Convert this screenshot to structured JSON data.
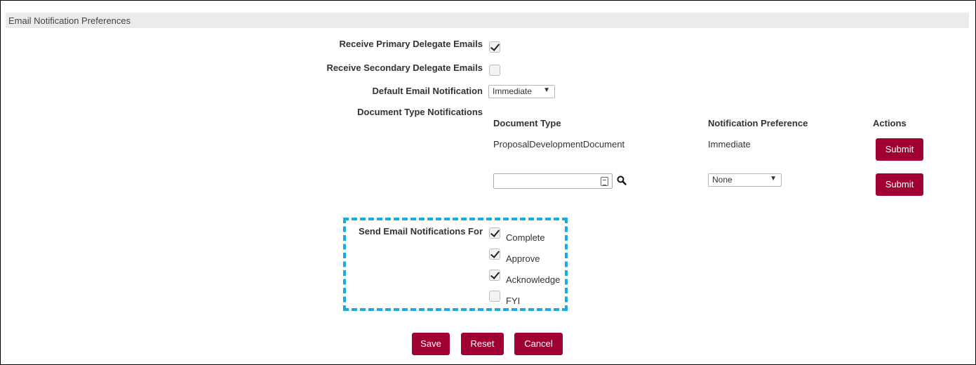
{
  "section": {
    "title": "Email Notification Preferences"
  },
  "fields": {
    "primary_delegate": {
      "label": "Receive Primary Delegate Emails",
      "checked": true
    },
    "secondary_delegate": {
      "label": "Receive Secondary Delegate Emails",
      "checked": false
    },
    "default_notification": {
      "label": "Default Email Notification",
      "value": "Immediate"
    },
    "doc_type_notifications": {
      "label": "Document Type Notifications"
    }
  },
  "doc_table": {
    "headers": {
      "doc_type": "Document Type",
      "pref": "Notification Preference",
      "actions": "Actions"
    },
    "rows": [
      {
        "doc_type": "ProposalDevelopmentDocument",
        "pref": "Immediate",
        "action": "Submit"
      }
    ],
    "new_row": {
      "doc_type_value": "",
      "pref_value": "None",
      "action": "Submit"
    }
  },
  "send_for": {
    "label": "Send Email Notifications For",
    "options": [
      {
        "label": "Complete",
        "checked": true
      },
      {
        "label": "Approve",
        "checked": true
      },
      {
        "label": "Acknowledge",
        "checked": true
      },
      {
        "label": "FYI",
        "checked": false
      }
    ]
  },
  "buttons": {
    "save": "Save",
    "reset": "Reset",
    "cancel": "Cancel"
  },
  "colors": {
    "button": "#a10033",
    "highlight_border": "#1ba9e1",
    "header_bg": "#ebebeb"
  },
  "icons": {
    "search": "magnifier-icon",
    "lookup": "calendar-lookup-icon",
    "dropdown": "chevron-down-icon"
  }
}
